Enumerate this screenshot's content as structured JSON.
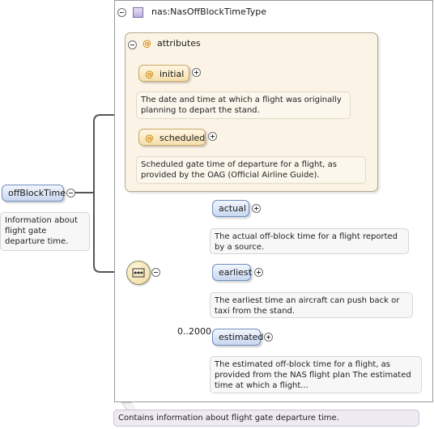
{
  "root_element": {
    "name": "offBlockTime",
    "doc": "Information about flight gate departure time."
  },
  "type": {
    "name": "nas:NasOffBlockTimeType"
  },
  "attributes_group": {
    "label": "attributes",
    "items": [
      {
        "name": "initial",
        "doc": "The date and time at which a flight was originally planning to depart the stand."
      },
      {
        "name": "scheduled",
        "doc": "Scheduled gate time of departure for a flight, as provided by the OAG (Official Airline Guide)."
      }
    ]
  },
  "sequence": {
    "children": [
      {
        "name": "actual",
        "doc": "The actual off-block time for a flight reported by a source.",
        "occurs": ""
      },
      {
        "name": "earliest",
        "doc": "The earliest time an aircraft can push back or taxi from the stand.",
        "occurs": ""
      },
      {
        "name": "estimated",
        "doc": "The estimated off-block time for a flight, as provided from the NAS flight plan The estimated time at which a flight...",
        "occurs": "0..2000"
      }
    ]
  },
  "type_doc": "Contains information about flight gate departure time.",
  "colors": {
    "element_border": "#6f8fbf",
    "attribute_border": "#c7a66b",
    "attribute_panel": "#fbf4e6",
    "connector": "#555555"
  },
  "icons": [
    "minus-icon",
    "plus-icon",
    "type-icon",
    "sequence-icon",
    "attribute-icon"
  ]
}
